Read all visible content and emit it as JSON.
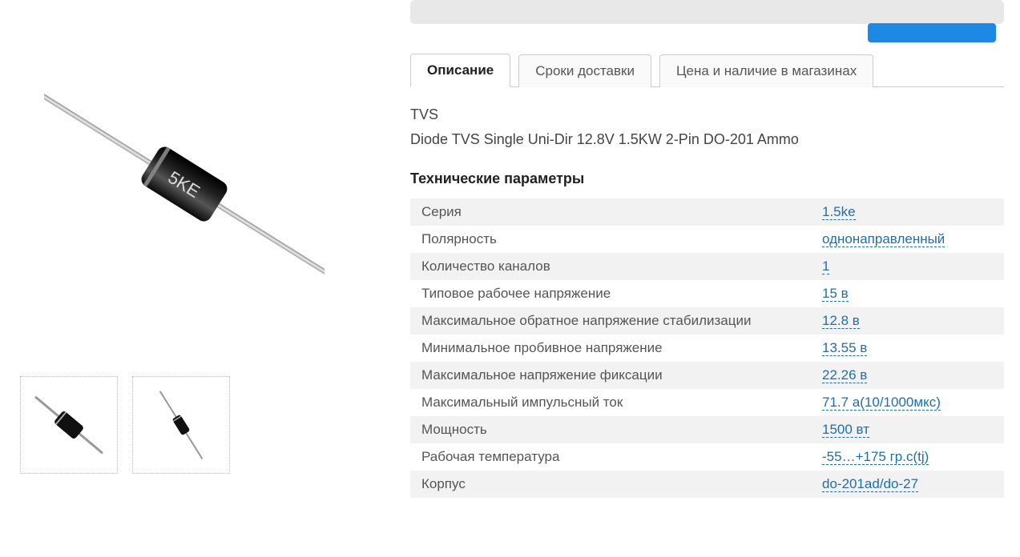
{
  "tabs": [
    {
      "label": "Описание",
      "active": true
    },
    {
      "label": "Сроки доставки",
      "active": false
    },
    {
      "label": "Цена и наличие в магазинах",
      "active": false
    }
  ],
  "description": {
    "line1": "TVS",
    "line2": "Diode TVS Single Uni-Dir 12.8V 1.5KW 2-Pin DO-201 Ammo"
  },
  "params_title": "Технические параметры",
  "params": [
    {
      "name": "Серия",
      "value": "1.5ke"
    },
    {
      "name": "Полярность",
      "value": "однонаправленный"
    },
    {
      "name": "Количество каналов",
      "value": "1"
    },
    {
      "name": "Типовое рабочее напряжение",
      "value": "15 в"
    },
    {
      "name": "Максимальное обратное напряжение стабилизации",
      "value": "12.8 в"
    },
    {
      "name": "Минимальное пробивное напряжение",
      "value": "13.55 в"
    },
    {
      "name": "Максимальное напряжение фиксации",
      "value": "22.26 в"
    },
    {
      "name": "Максимальный импульсный ток",
      "value": "71.7 а(10/1000мкс)"
    },
    {
      "name": "Мощность",
      "value": "1500 вт"
    },
    {
      "name": "Рабочая температура",
      "value": "-55…+175 гр.c(tj)"
    },
    {
      "name": "Корпус",
      "value": "do-201ad/do-27"
    }
  ],
  "product_marking": "5KE"
}
